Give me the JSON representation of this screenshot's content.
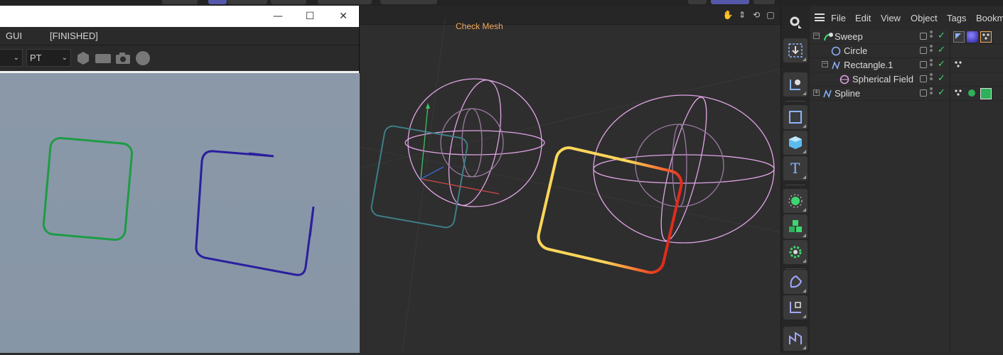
{
  "render_window": {
    "menu": {
      "item1": "GUI",
      "status": "[FINISHED]"
    },
    "toolbar": {
      "select1_value": "",
      "select2_value": "PT"
    },
    "window_controls": {
      "minimize": "—",
      "maximize": "☐",
      "close": "✕"
    }
  },
  "viewport": {
    "mode_label": "Check Mesh",
    "nav_icons": [
      "hand-pan-icon",
      "move-icon",
      "rotate-icon",
      "maximize-view-icon"
    ]
  },
  "palette": {
    "tools": [
      "settings-icon",
      "import-icon",
      "coordinate-system-icon",
      "cube-wire-icon",
      "cube-icon",
      "text-icon",
      "generator-icon",
      "cloner-icon",
      "deformer-icon",
      "spline-pen-icon",
      "axis-icon",
      "polygon-pen-icon"
    ]
  },
  "object_manager": {
    "menu": [
      "File",
      "Edit",
      "View",
      "Object",
      "Tags",
      "Bookm"
    ],
    "objects": [
      {
        "name": "Sweep",
        "depth": 0,
        "expander": "−",
        "icon": "sweep-icon"
      },
      {
        "name": "Circle",
        "depth": 1,
        "expander": "",
        "icon": "circle-icon"
      },
      {
        "name": "Rectangle.1",
        "depth": 1,
        "expander": "−",
        "icon": "spline-icon"
      },
      {
        "name": "Spherical Field",
        "depth": 2,
        "expander": "",
        "icon": "spherical-field-icon"
      },
      {
        "name": "Spline",
        "depth": 0,
        "expander": "+",
        "icon": "spline-icon"
      }
    ],
    "colors": {
      "check": "#3ed66f",
      "accent": "#5558a8"
    }
  }
}
